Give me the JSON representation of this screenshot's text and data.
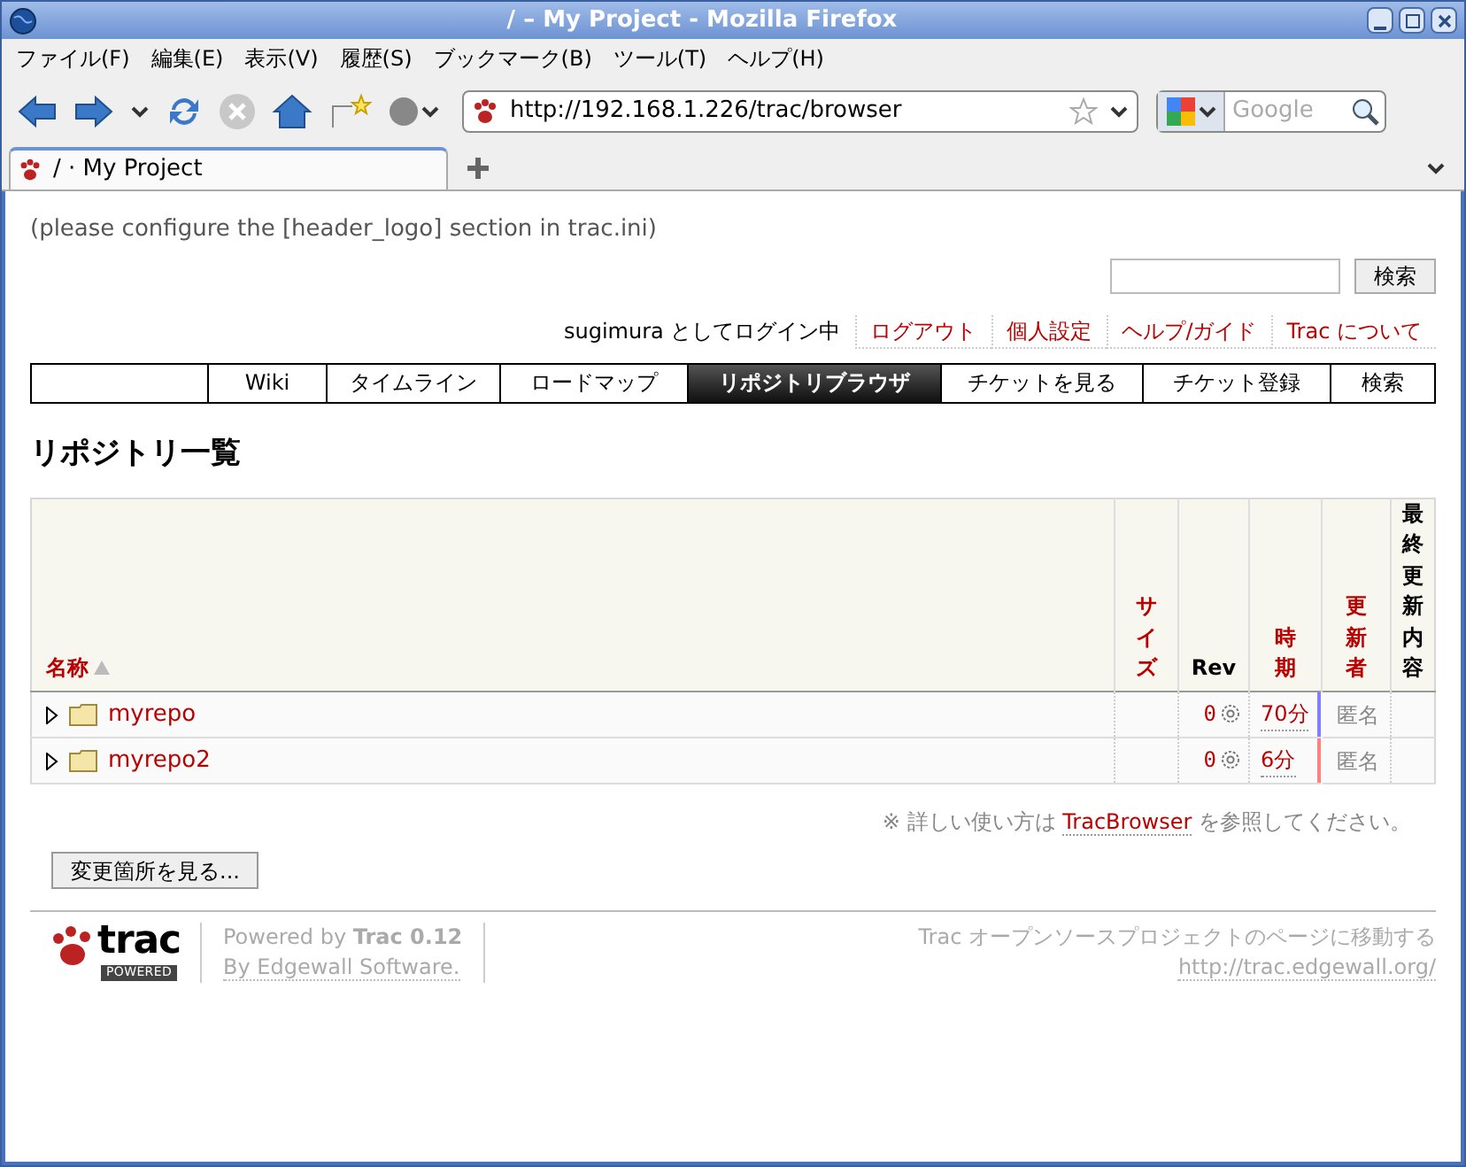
{
  "window": {
    "title": "/ – My Project - Mozilla Firefox"
  },
  "menu": [
    "ファイル(F)",
    "編集(E)",
    "表示(V)",
    "履歴(S)",
    "ブックマーク(B)",
    "ツール(T)",
    "ヘルプ(H)"
  ],
  "address_bar": {
    "url": "http://192.168.1.226/trac/browser"
  },
  "search_bar": {
    "placeholder": "Google"
  },
  "tabs": [
    {
      "label": "/ · My Project",
      "selected": true
    }
  ],
  "page": {
    "header_note": "(please configure the [header_logo] section in trac.ini)",
    "search_button": "検索",
    "meta_nav": [
      {
        "label": "sugimura としてログイン中",
        "kind": "text"
      },
      {
        "label": "ログアウト",
        "kind": "link"
      },
      {
        "label": "個人設定",
        "kind": "link"
      },
      {
        "label": "ヘルプ/ガイド",
        "kind": "link"
      },
      {
        "label": "Trac について",
        "kind": "link"
      }
    ],
    "main_nav": [
      {
        "label": "Wiki",
        "selected": false
      },
      {
        "label": "タイムライン",
        "selected": false
      },
      {
        "label": "ロードマップ",
        "selected": false
      },
      {
        "label": "リポジトリブラウザ",
        "selected": true
      },
      {
        "label": "チケットを見る",
        "selected": false
      },
      {
        "label": "チケット登録",
        "selected": false
      },
      {
        "label": "検索",
        "selected": false
      }
    ],
    "heading": "リポジトリ一覧",
    "table": {
      "columns": [
        {
          "label": "名称",
          "sortable": true,
          "sorted": true
        },
        {
          "label": "サイズ",
          "sortable": true,
          "sorted": false
        },
        {
          "label": "Rev",
          "sortable": false,
          "sorted": false
        },
        {
          "label": "時期",
          "sortable": true,
          "sorted": false
        },
        {
          "label": "更新者",
          "sortable": true,
          "sorted": false
        },
        {
          "label": "最終更新内容",
          "sortable": false,
          "sorted": false
        }
      ],
      "rows": [
        {
          "name": "myrepo",
          "rev": "0",
          "age": "70分",
          "color": "#8080ff",
          "author": "匿名"
        },
        {
          "name": "myrepo2",
          "rev": "0",
          "age": "6分",
          "color": "#ff8080",
          "author": "匿名"
        }
      ]
    },
    "help": {
      "prefix": "※ 詳しい使い方は",
      "link": "TracBrowser",
      "suffix": "を参照してください。"
    },
    "changes_button": "変更箇所を見る...",
    "footer": {
      "logo": "trac",
      "logo_badge": "POWERED",
      "powered": "Powered by **Trac 0.12**",
      "by": "By Edgewall Software.",
      "visit": "Trac オープンソースプロジェクトのページに移動する",
      "url": "http://trac.edgewall.org/"
    }
  }
}
